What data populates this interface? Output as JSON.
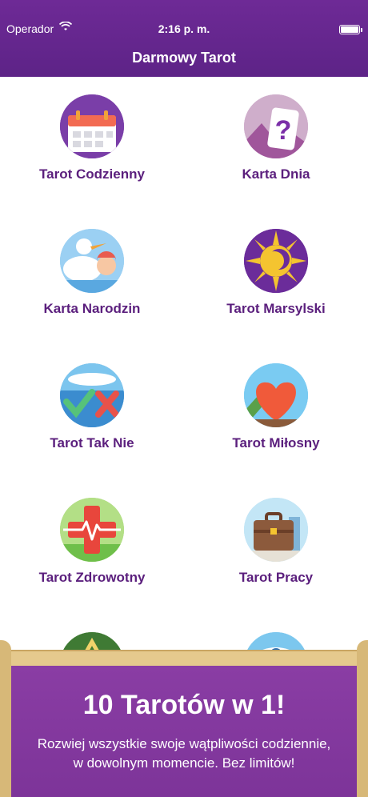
{
  "status_bar": {
    "carrier": "Operador",
    "time": "2:16 p. m."
  },
  "nav": {
    "title": "Darmowy Tarot"
  },
  "tiles": [
    {
      "label": "Tarot Codzienny",
      "icon": "calendar-icon"
    },
    {
      "label": "Karta Dnia",
      "icon": "question-card-icon"
    },
    {
      "label": "Karta Narodzin",
      "icon": "stork-baby-icon"
    },
    {
      "label": "Tarot Marsylski",
      "icon": "sun-moon-icon"
    },
    {
      "label": "Tarot Tak Nie",
      "icon": "check-cross-icon"
    },
    {
      "label": "Tarot Miłosny",
      "icon": "heart-icon"
    },
    {
      "label": "Tarot Zdrowotny",
      "icon": "health-cross-icon"
    },
    {
      "label": "Tarot Pracy",
      "icon": "briefcase-icon"
    }
  ],
  "banner": {
    "title": "10 Tarotów w 1!",
    "subtitle_line1": "Rozwiej wszystkie swoje wątpliwości codziennie,",
    "subtitle_line2": "w dowolnym momencie. Bez limitów!"
  }
}
